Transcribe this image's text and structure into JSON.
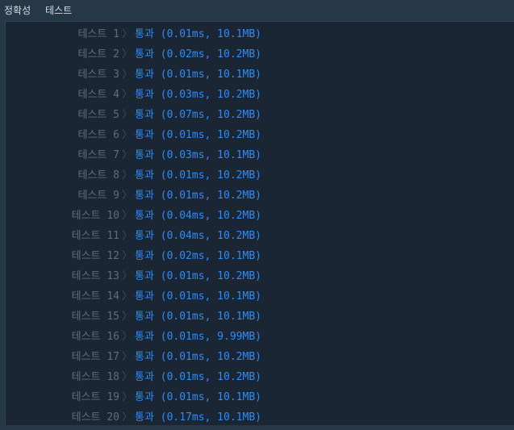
{
  "header": {
    "tab_accuracy": "정확성",
    "tab_test": "테스트"
  },
  "results": {
    "separator": "〉",
    "rows": [
      {
        "label": "테스트 1",
        "result": "통과 (0.01ms, 10.1MB)"
      },
      {
        "label": "테스트 2",
        "result": "통과 (0.02ms, 10.2MB)"
      },
      {
        "label": "테스트 3",
        "result": "통과 (0.01ms, 10.1MB)"
      },
      {
        "label": "테스트 4",
        "result": "통과 (0.03ms, 10.2MB)"
      },
      {
        "label": "테스트 5",
        "result": "통과 (0.07ms, 10.2MB)"
      },
      {
        "label": "테스트 6",
        "result": "통과 (0.01ms, 10.2MB)"
      },
      {
        "label": "테스트 7",
        "result": "통과 (0.03ms, 10.1MB)"
      },
      {
        "label": "테스트 8",
        "result": "통과 (0.01ms, 10.2MB)"
      },
      {
        "label": "테스트 9",
        "result": "통과 (0.01ms, 10.2MB)"
      },
      {
        "label": "테스트 10",
        "result": "통과 (0.04ms, 10.2MB)"
      },
      {
        "label": "테스트 11",
        "result": "통과 (0.04ms, 10.2MB)"
      },
      {
        "label": "테스트 12",
        "result": "통과 (0.02ms, 10.1MB)"
      },
      {
        "label": "테스트 13",
        "result": "통과 (0.01ms, 10.2MB)"
      },
      {
        "label": "테스트 14",
        "result": "통과 (0.01ms, 10.1MB)"
      },
      {
        "label": "테스트 15",
        "result": "통과 (0.01ms, 10.1MB)"
      },
      {
        "label": "테스트 16",
        "result": "통과 (0.01ms, 9.99MB)"
      },
      {
        "label": "테스트 17",
        "result": "통과 (0.01ms, 10.2MB)"
      },
      {
        "label": "테스트 18",
        "result": "통과 (0.01ms, 10.2MB)"
      },
      {
        "label": "테스트 19",
        "result": "통과 (0.01ms, 10.1MB)"
      },
      {
        "label": "테스트 20",
        "result": "통과 (0.17ms, 10.1MB)"
      }
    ]
  },
  "colors": {
    "pass": "#2f8cf7",
    "label": "#5d6d7e",
    "panel_bg": "#1a2634",
    "page_bg": "#263747"
  }
}
